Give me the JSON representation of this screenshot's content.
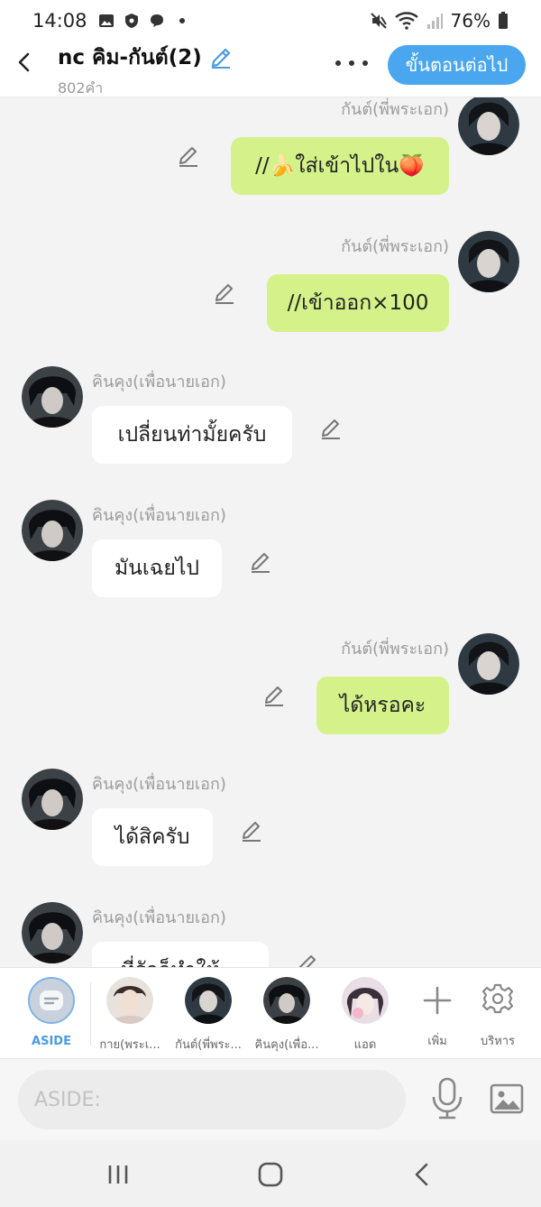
{
  "status_bar": {
    "time": "14:08",
    "battery": "76%"
  },
  "header": {
    "title": "nc คิม-กันต์(2)",
    "word_count": "802คำ",
    "next_button": "ขั้นตอนต่อไป"
  },
  "messages": [
    {
      "side": "right",
      "name": "กันต์(พี่พระเอก)",
      "text": "//🍌ใส่เข้าไปใน🍑"
    },
    {
      "side": "right",
      "name": "กันต์(พี่พระเอก)",
      "text": "//เข้าออก×100"
    },
    {
      "side": "left",
      "name": "คินคุง(เพื่อนายเอก)",
      "text": "เปลี่ยนท่ามั้ยครับ"
    },
    {
      "side": "left",
      "name": "คินคุง(เพื่อนายเอก)",
      "text": "มันเฉยไป"
    },
    {
      "side": "right",
      "name": "กันต์(พี่พระเอก)",
      "text": "ได้หรอคะ"
    },
    {
      "side": "left",
      "name": "คินคุง(เพื่อนายเอก)",
      "text": "ได้สิครับ"
    },
    {
      "side": "left",
      "name": "คินคุง(เพื่อนายเอก)",
      "text": "ที่รักก็ทำให้..."
    }
  ],
  "characters": {
    "aside": "ASIDE",
    "char1": "กาย(พระเ...",
    "char2": "กันต์(พี่พระ...",
    "char3": "คินคุง(เพื่อ...",
    "char4": "แอด",
    "add": "เพิ่ม",
    "manage": "บริหาร"
  },
  "input": {
    "placeholder": "ASIDE:"
  },
  "colors": {
    "accent": "#4aa6ee",
    "bubble_right": "#d5f28a",
    "bubble_left": "#ffffff"
  },
  "icons": [
    "back-arrow-icon",
    "pencil-icon",
    "more-icon",
    "edit-icon",
    "plus-icon",
    "gear-icon",
    "mic-icon",
    "image-icon",
    "recents-icon",
    "home-icon",
    "nav-back-icon"
  ]
}
